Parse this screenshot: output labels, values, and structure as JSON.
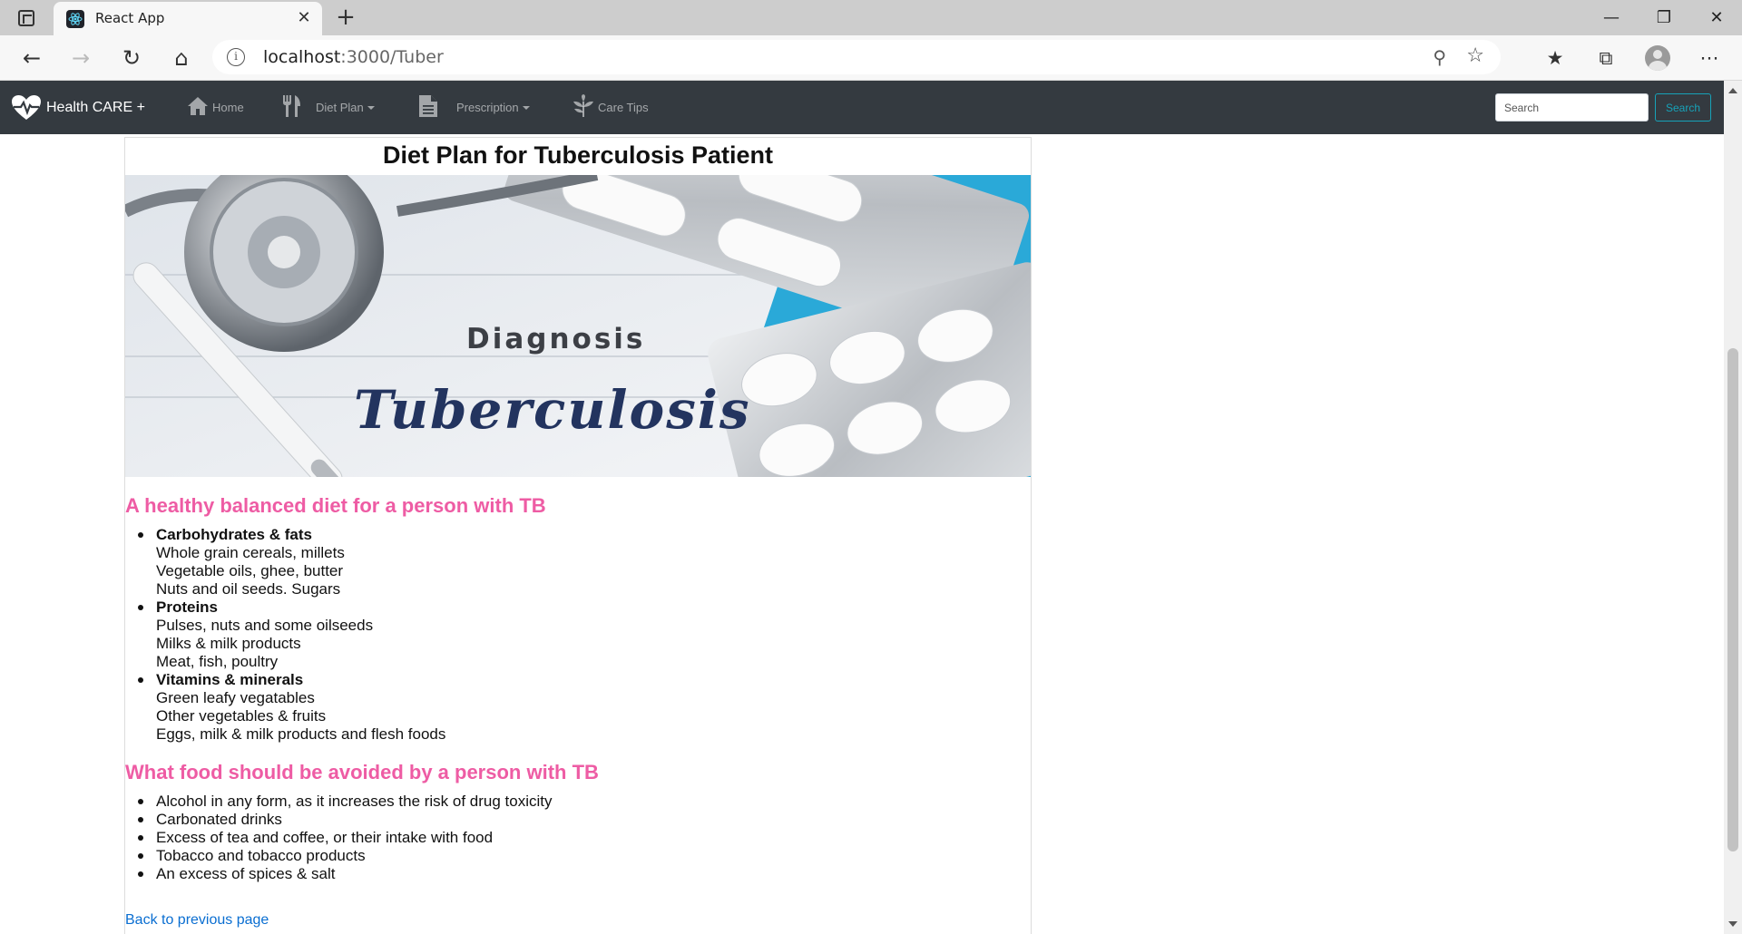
{
  "browser": {
    "tab_title": "React App",
    "tab_close": "✕",
    "new_tab": "+",
    "url_host": "localhost",
    "url_path": ":3000/Tuber",
    "window_controls": {
      "minimize": "—",
      "restore": "❐",
      "close": "✕"
    }
  },
  "navbar": {
    "brand": "Health CARE +",
    "items": [
      {
        "label": "Home",
        "icon": "home-icon"
      },
      {
        "label": "Diet Plan",
        "icon": "utensils-icon",
        "dropdown": true
      },
      {
        "label": "Prescription",
        "icon": "file-icon",
        "dropdown": true
      },
      {
        "label": "Care Tips",
        "icon": "leaf-icon"
      }
    ],
    "search_placeholder": "Search",
    "search_button": "Search"
  },
  "page": {
    "title": "Diet Plan for Tuberculosis Patient",
    "hero": {
      "word1": "Diagnosis",
      "word2": "Tuberculosis"
    },
    "section1": {
      "heading": "A healthy balanced diet for a person with TB",
      "groups": [
        {
          "title": "Carbohydrates & fats",
          "lines": [
            "Whole grain cereals, millets",
            "Vegetable oils, ghee, butter",
            "Nuts and oil seeds. Sugars"
          ]
        },
        {
          "title": "Proteins",
          "lines": [
            "Pulses, nuts and some oilseeds",
            "Milks & milk products",
            "Meat, fish, poultry"
          ]
        },
        {
          "title": "Vitamins & minerals",
          "lines": [
            "Green leafy vegatables",
            "Other vegetables & fruits",
            "Eggs, milk & milk products and flesh foods"
          ]
        }
      ]
    },
    "section2": {
      "heading": "What food should be avoided by a person with TB",
      "items": [
        "Alcohol in any form, as it increases the risk of drug toxicity",
        "Carbonated drinks",
        "Excess of tea and coffee, or their intake with food",
        "Tobacco and tobacco products",
        "An excess of spices & salt"
      ]
    },
    "back_link": "Back to previous page"
  },
  "colors": {
    "navbar_bg": "#343a40",
    "heading_pink": "#ee5ca4",
    "link_blue": "#0a6ed1",
    "search_teal": "#17a2b8"
  }
}
